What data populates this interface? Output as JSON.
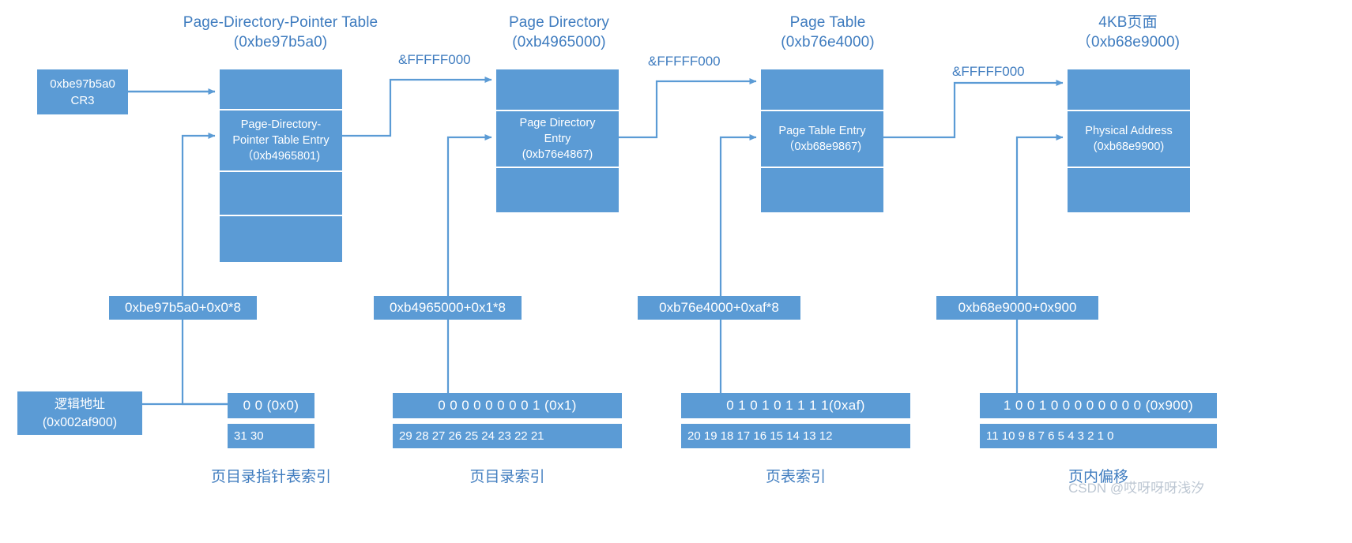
{
  "diagram": {
    "title_hint": "x86 PAE 4KB page address translation",
    "accent_color": "#5b9bd5",
    "title_color": "#3f7cbf",
    "arrow_color": "#5b9bd5"
  },
  "cr3": {
    "text": "0xbe97b5a0\nCR3"
  },
  "columns": [
    {
      "id": "pdpt",
      "title": "Page-Directory-Pointer Table\n(0xbe97b5a0)",
      "entry_text": "Page-Directory-\nPointer Table Entry\n（0xb4965801)",
      "mask_label": "&FFFFF000",
      "calc": "0xbe97b5a0+0x0*8",
      "bits": "0  0  (0x0)",
      "bit_numbers": "31 30",
      "bottom_label": "页目录指针表索引"
    },
    {
      "id": "pd",
      "title": "Page Directory\n(0xb4965000)",
      "entry_text": "Page Directory\nEntry\n(0xb76e4867)",
      "mask_label": "&FFFFF000",
      "calc": "0xb4965000+0x1*8",
      "bits": "0  0  0   0  0  0  0   0  1 (0x1)",
      "bit_numbers": "29 28 27 26 25 24 23 22 21",
      "bottom_label": "页目录索引"
    },
    {
      "id": "pt",
      "title": "Page Table\n(0xb76e4000)",
      "entry_text": "Page Table Entry\n（0xb68e9867)",
      "mask_label": "&FFFFF000",
      "calc": "0xb76e4000+0xaf*8",
      "bits": "0  1  0  1  0  1  1  1  1(0xaf)",
      "bit_numbers": "20 19 18 17 16 15 14 13 12",
      "bottom_label": "页表索引"
    },
    {
      "id": "page",
      "title": "4KB页面\n（0xb68e9000)",
      "entry_text": "Physical Address\n(0xb68e9900)",
      "mask_label": "&FFFFF000",
      "calc": "0xb68e9000+0x900",
      "bits": "1 0 0 1 0 0 0 0 0 0 0 0  (0x900)",
      "bit_numbers": "11 10 9 8 7 6 5 4 3 2 1 0",
      "bottom_label": "页内偏移"
    }
  ],
  "logical_address": {
    "text": "逻辑地址\n(0x002af900)"
  },
  "watermark": {
    "text": "CSDN @哎呀呀呀浅汐"
  }
}
